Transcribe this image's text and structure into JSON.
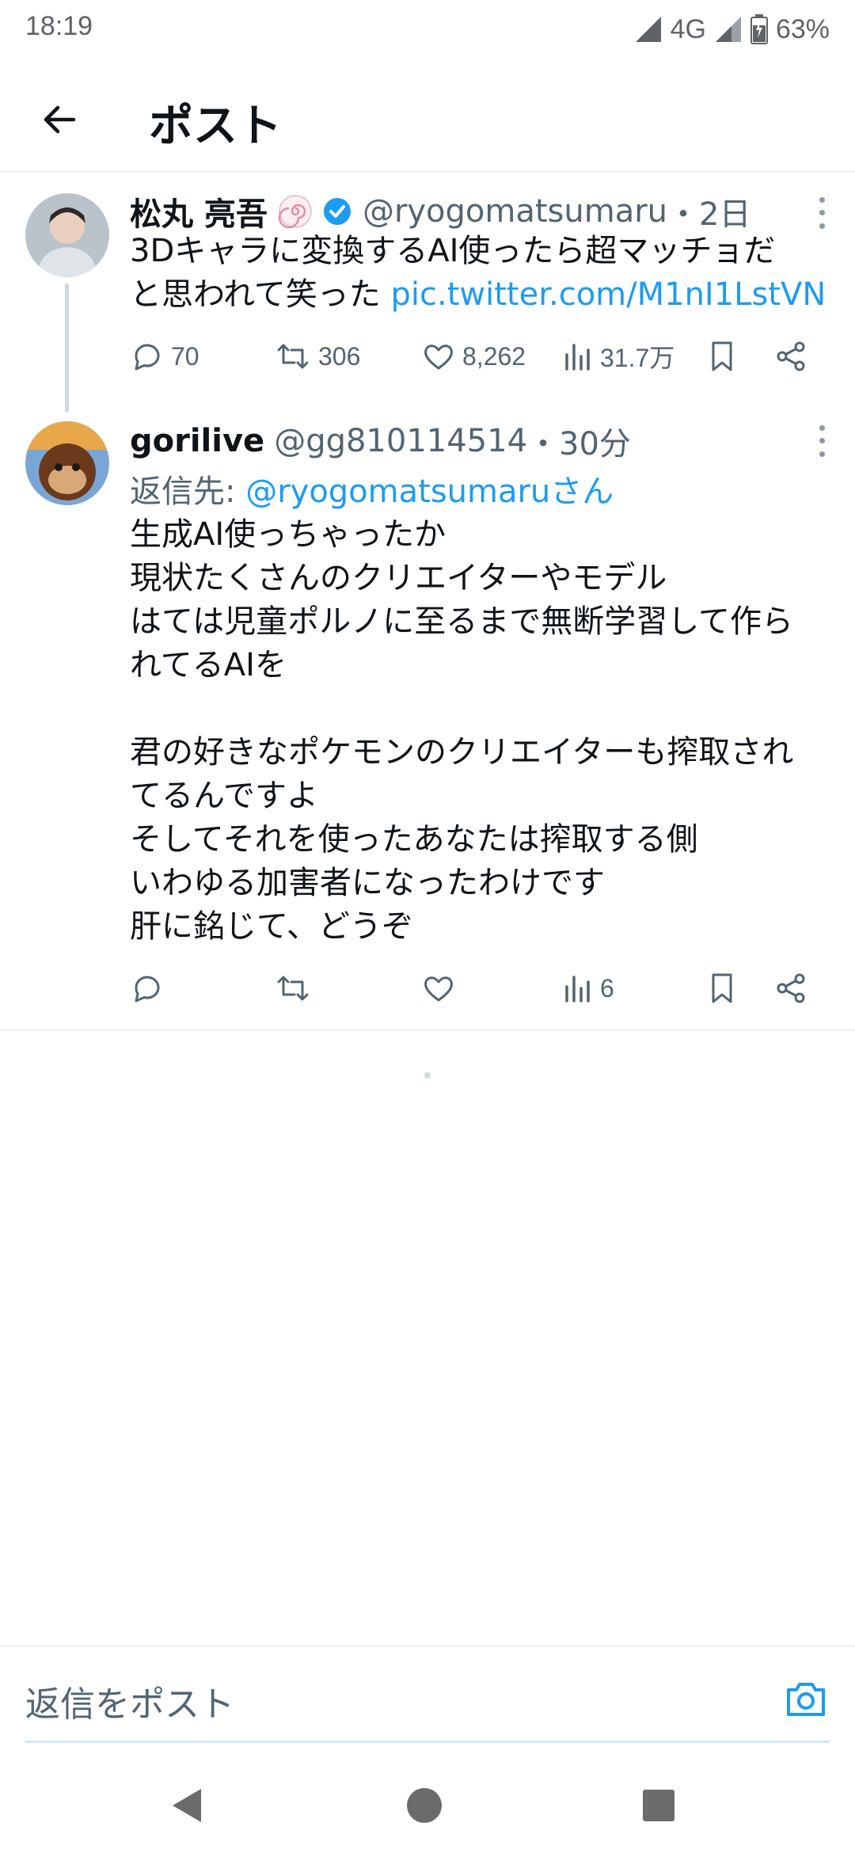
{
  "status": {
    "time": "18:19",
    "network": "4G",
    "battery": "63%"
  },
  "header": {
    "title": "ポスト"
  },
  "tweets": [
    {
      "name": "松丸 亮吾",
      "handle": "@ryogomatsumaru",
      "time": "・2日",
      "text_line1": "3Dキャラに変換するAI使ったら超マッチョだ",
      "text_line2": "と思われて笑った ",
      "link": "pic.twitter.com/M1nI1LstVN",
      "replies": "70",
      "retweets": "306",
      "likes": "8,262",
      "views": "31.7万"
    },
    {
      "name": "gorilive",
      "handle": "@gg810114514",
      "time": "・30分",
      "reply_to_label": "返信先: ",
      "reply_to_link": "@ryogomatsumaruさん",
      "text": "生成AI使っちゃったか\n現状たくさんのクリエイターやモデル\nはては児童ポルノに至るまで無断学習して作ら\nれてるAIを\n\n君の好きなポケモンのクリエイターも搾取され\nてるんですよ\nそしてそれを使ったあなたは搾取する側\nいわゆる加害者になったわけです\n肝に銘じて、どうぞ",
      "views": "6"
    }
  ],
  "reply_bar": {
    "placeholder": "返信をポスト"
  },
  "icons": {
    "back": "arrow-left-icon",
    "verified": "verified-badge-icon",
    "camera": "camera-icon"
  },
  "colors": {
    "accent": "#1d9bf0",
    "secondary_text": "#536471"
  }
}
